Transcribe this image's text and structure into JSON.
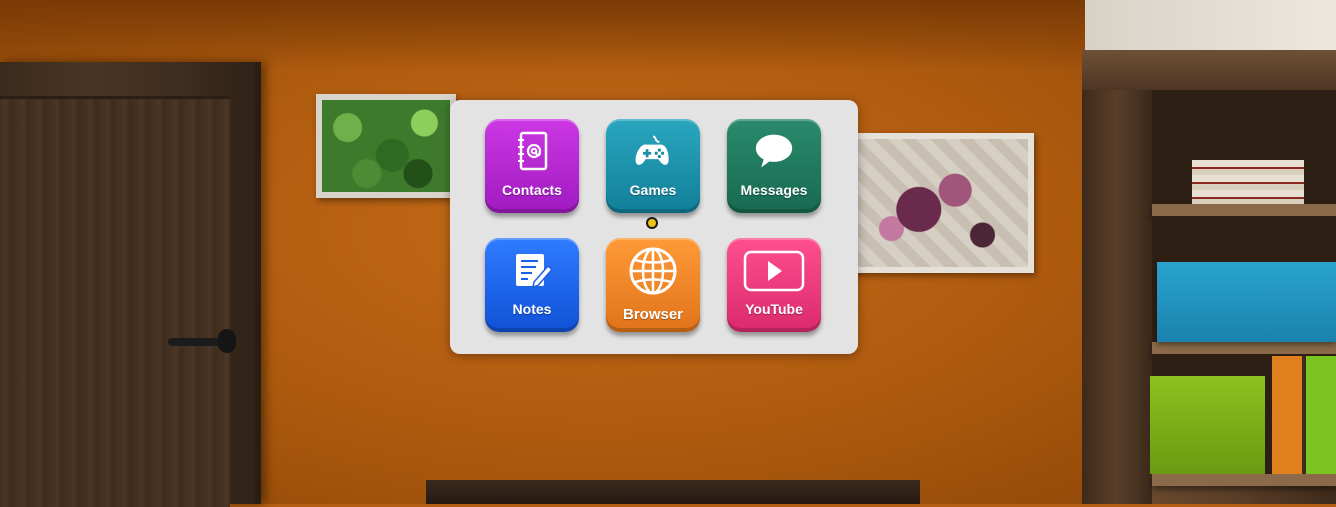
{
  "launcher": {
    "apps": [
      {
        "id": "contacts",
        "label": "Contacts",
        "icon": "contacts-book-icon",
        "color_top": "#cc38e4",
        "color_bottom": "#a01ac0"
      },
      {
        "id": "games",
        "label": "Games",
        "icon": "gamepad-icon",
        "color_top": "#2aa6bf",
        "color_bottom": "#127f98"
      },
      {
        "id": "messages",
        "label": "Messages",
        "icon": "speech-bubble-icon",
        "color_top": "#2a8a6c",
        "color_bottom": "#176a51"
      },
      {
        "id": "notes",
        "label": "Notes",
        "icon": "notepad-pencil-icon",
        "color_top": "#2f7bff",
        "color_bottom": "#1052d6"
      },
      {
        "id": "browser",
        "label": "Browser",
        "icon": "globe-icon",
        "color_top": "#ff9a38",
        "color_bottom": "#e0731a"
      },
      {
        "id": "youtube",
        "label": "YouTube",
        "icon": "play-button-icon",
        "color_top": "#ff4f8f",
        "color_bottom": "#db2a6c"
      }
    ]
  },
  "colors": {
    "panel_bg": "#e3e3e3",
    "cursor": "#f2c21a"
  }
}
